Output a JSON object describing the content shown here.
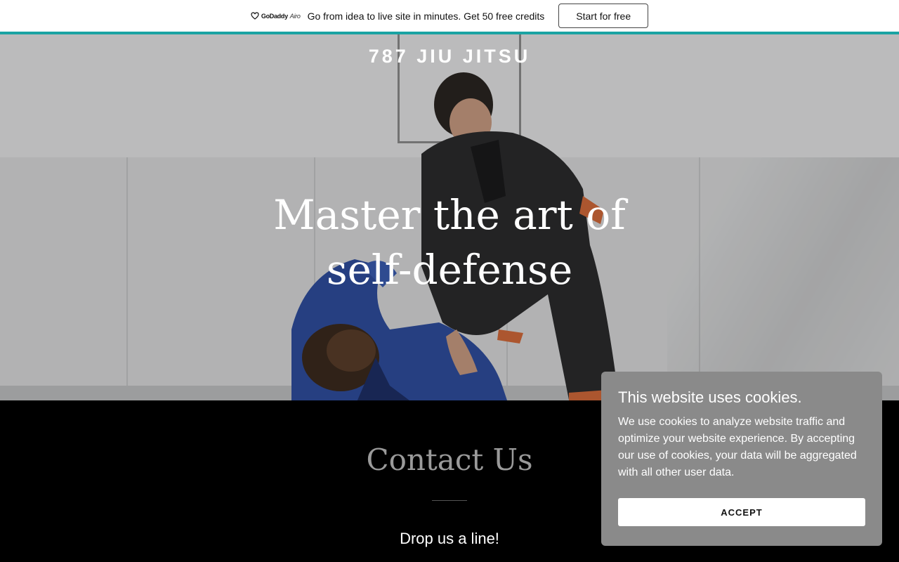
{
  "promo": {
    "brand_name": "GoDaddy",
    "brand_suffix": "Airo",
    "text": "Go from idea to live site in minutes. Get 50 free credits",
    "cta_label": "Start for free",
    "accent_color": "#1aa3a3"
  },
  "hero": {
    "site_title": "787 JIU JITSU",
    "headline": "Master the art of self-defense"
  },
  "contact": {
    "title": "Contact Us",
    "subtitle": "Drop us a line!"
  },
  "cookie": {
    "title": "This website uses cookies.",
    "body": "We use cookies to analyze website traffic and optimize your website experience. By accepting our use of cookies, your data will be aggregated with all other user data.",
    "accept_label": "ACCEPT"
  }
}
